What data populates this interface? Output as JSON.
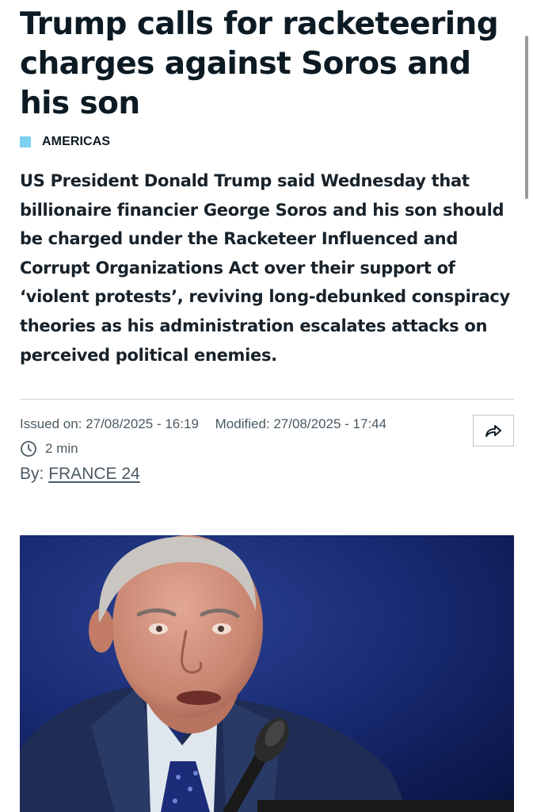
{
  "article": {
    "headline": "Trump calls for racketeering charges against Soros and his son",
    "category": "AMERICAS",
    "lead": "US President Donald Trump said Wednesday that billionaire financier George Soros and his son should be charged under the Racketeer Influenced and Corrupt Organizations Act over their support of ‘violent protests’, reviving long-debunked conspiracy theories as his administration escalates attacks on perceived political enemies."
  },
  "meta": {
    "issued": "Issued on: 27/08/2025 - 16:19",
    "modified": "Modified: 27/08/2025 - 17:44",
    "read_time": "2 min",
    "by_prefix": "By:",
    "author": "FRANCE 24"
  },
  "icons": {
    "clock": "clock-icon",
    "share": "share-arrow-icon"
  },
  "colors": {
    "category_accent": "#7ed0f1",
    "headline": "#0c1a23",
    "meta_text": "#4b5a63",
    "photo_background": "#16276a"
  }
}
